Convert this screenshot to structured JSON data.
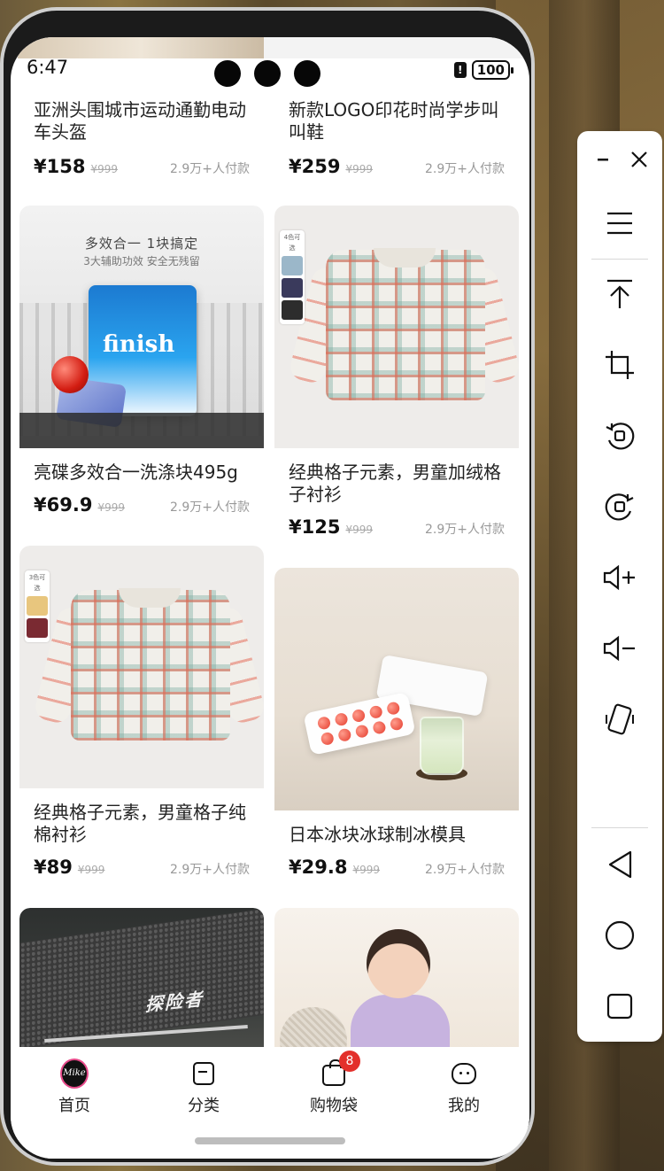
{
  "status": {
    "time": "6:47",
    "battery": "100",
    "alert": "!"
  },
  "products": [
    {
      "title": "亚洲头围城市运动通勤电动车头盔",
      "price": "¥158",
      "original": "¥999",
      "sold": "2.9万+人付款"
    },
    {
      "title": "新款LOGO印花时尚学步叫叫鞋",
      "price": "¥259",
      "original": "¥999",
      "sold": "2.9万+人付款"
    },
    {
      "title": "亮碟多效合一洗涤块495g",
      "price": "¥69.9",
      "original": "¥999",
      "sold": "2.9万+人付款",
      "image_text": {
        "headline": "多效合一  1块搞定",
        "sub": "3大辅助功效 安全无残留",
        "brand": "finish"
      }
    },
    {
      "title": "经典格子元素，男童加绒格子衬衫",
      "price": "¥125",
      "original": "¥999",
      "sold": "2.9万+人付款",
      "image_text": {
        "swatch_label": "4色可选"
      }
    },
    {
      "title": "经典格子元素，男童格子纯棉衬衫",
      "price": "¥89",
      "original": "¥999",
      "sold": "2.9万+人付款",
      "image_text": {
        "swatch_label": "3色可选"
      }
    },
    {
      "title": "日本冰块冰球制冰模具",
      "price": "¥29.8",
      "original": "¥999",
      "sold": "2.9万+人付款"
    },
    {
      "image_text": {
        "brand": "探险者"
      }
    },
    {}
  ],
  "bottom_nav": [
    {
      "label": "首页",
      "logo_text": "Mike"
    },
    {
      "label": "分类"
    },
    {
      "label": "购物袋",
      "badge": "8"
    },
    {
      "label": "我的"
    }
  ],
  "side_panel": {
    "icons": [
      "minimize-icon",
      "close-icon",
      "menu-icon",
      "scroll-top-icon",
      "crop-icon",
      "rotate-ccw-icon",
      "rotate-cw-icon",
      "volume-up-icon",
      "volume-down-icon",
      "shake-icon",
      "back-icon",
      "home-icon",
      "recents-icon"
    ]
  }
}
